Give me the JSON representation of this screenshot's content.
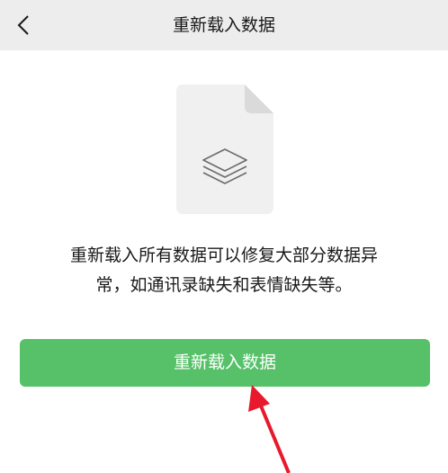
{
  "nav": {
    "back_icon": "chevron-left-icon",
    "title": "重新载入数据"
  },
  "illustration": {
    "icon": "document-layers-icon"
  },
  "description": {
    "line1": "重新载入所有数据可以修复大部分数据异",
    "line2": "常，如通讯录缺失和表情缺失等。"
  },
  "action": {
    "reload_label": "重新载入数据"
  },
  "annotation": {
    "arrow_icon": "red-arrow-icon",
    "arrow_color": "#e8192c"
  },
  "colors": {
    "nav_bg": "#ededed",
    "button_bg": "#57c16a",
    "doc_bg": "#f0f0f0",
    "doc_fold": "#dadada",
    "layers_stroke": "#6b6b6b"
  }
}
